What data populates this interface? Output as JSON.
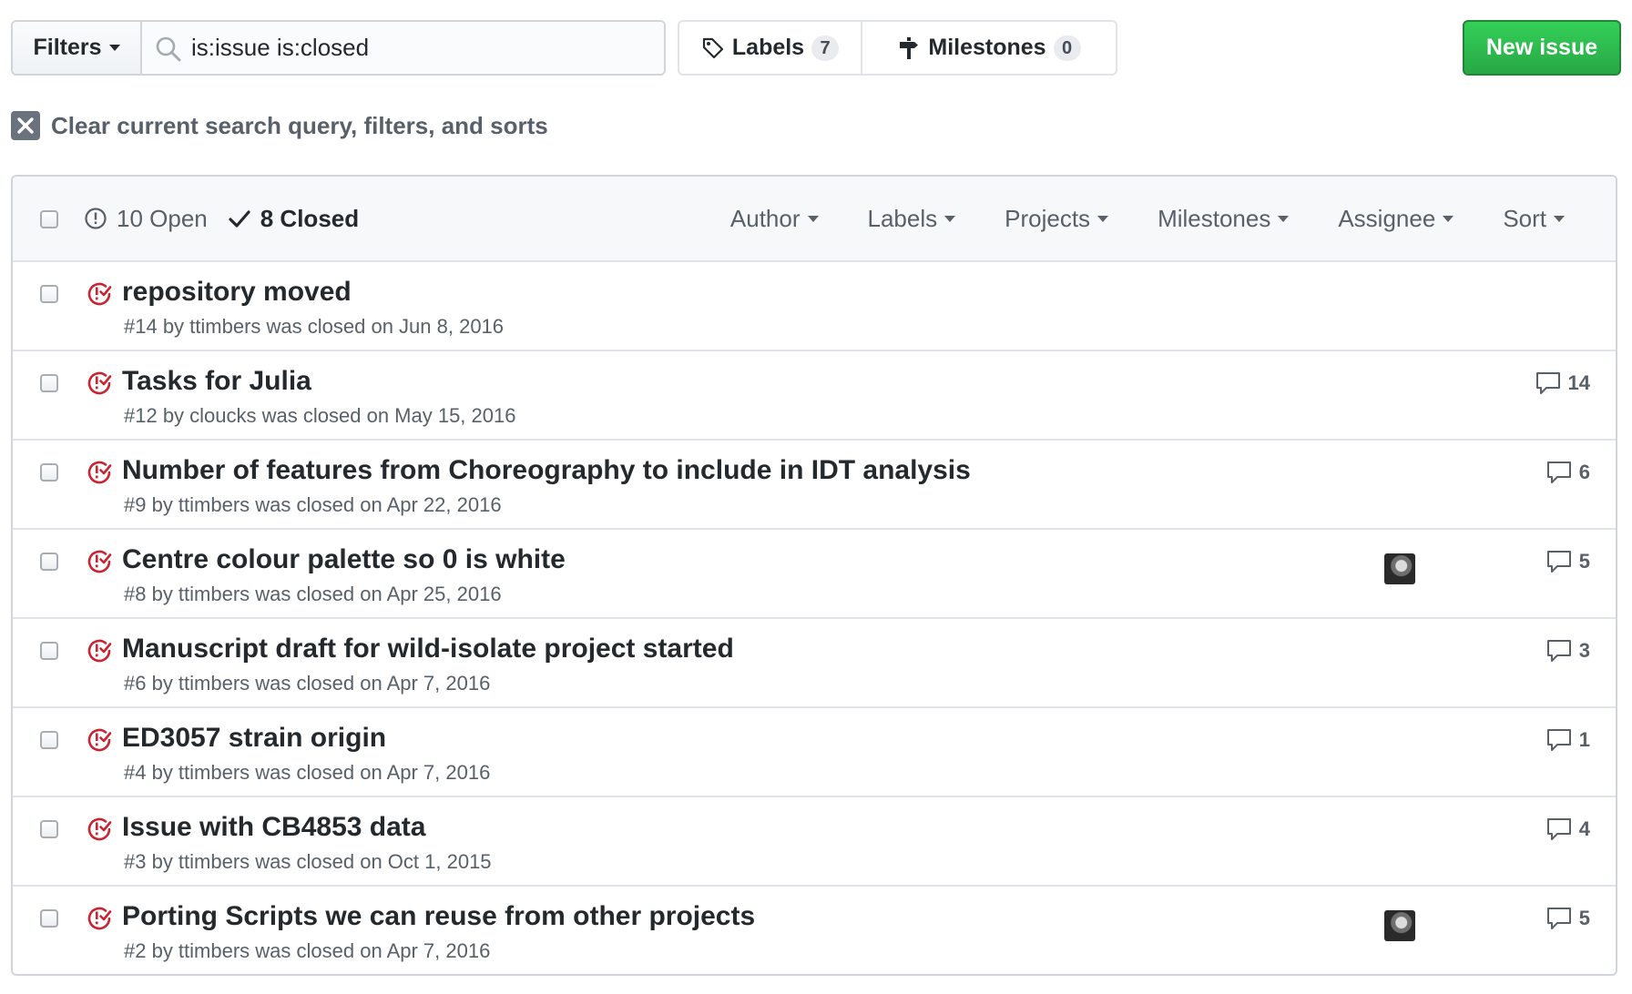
{
  "toolbar": {
    "filters_label": "Filters",
    "search_value": "is:issue is:closed",
    "labels_label": "Labels",
    "labels_count": "7",
    "milestones_label": "Milestones",
    "milestones_count": "0",
    "new_issue_label": "New issue"
  },
  "clear_filters_label": "Clear current search query, filters, and sorts",
  "header": {
    "open_label": "10 Open",
    "closed_label": "8 Closed",
    "filters": [
      "Author",
      "Labels",
      "Projects",
      "Milestones",
      "Assignee",
      "Sort"
    ]
  },
  "issues": [
    {
      "title": "repository moved",
      "meta": "#14 by ttimbers was closed on Jun 8, 2016",
      "comments": "",
      "avatar": false
    },
    {
      "title": "Tasks for Julia",
      "meta": "#12 by cloucks was closed on May 15, 2016",
      "comments": "14",
      "avatar": false
    },
    {
      "title": "Number of features from Choreography to include in IDT analysis",
      "meta": "#9 by ttimbers was closed on Apr 22, 2016",
      "comments": "6",
      "avatar": false
    },
    {
      "title": "Centre colour palette so 0 is white",
      "meta": "#8 by ttimbers was closed on Apr 25, 2016",
      "comments": "5",
      "avatar": true
    },
    {
      "title": "Manuscript draft for wild-isolate project started",
      "meta": "#6 by ttimbers was closed on Apr 7, 2016",
      "comments": "3",
      "avatar": false
    },
    {
      "title": "ED3057 strain origin",
      "meta": "#4 by ttimbers was closed on Apr 7, 2016",
      "comments": "1",
      "avatar": false
    },
    {
      "title": "Issue with CB4853 data",
      "meta": "#3 by ttimbers was closed on Oct 1, 2015",
      "comments": "4",
      "avatar": false
    },
    {
      "title": "Porting Scripts we can reuse from other projects",
      "meta": "#2 by ttimbers was closed on Apr 7, 2016",
      "comments": "5",
      "avatar": true
    }
  ],
  "colors": {
    "closed_issue": "#cb2431",
    "new_issue_button": "#28a745",
    "muted_text": "#586069"
  }
}
